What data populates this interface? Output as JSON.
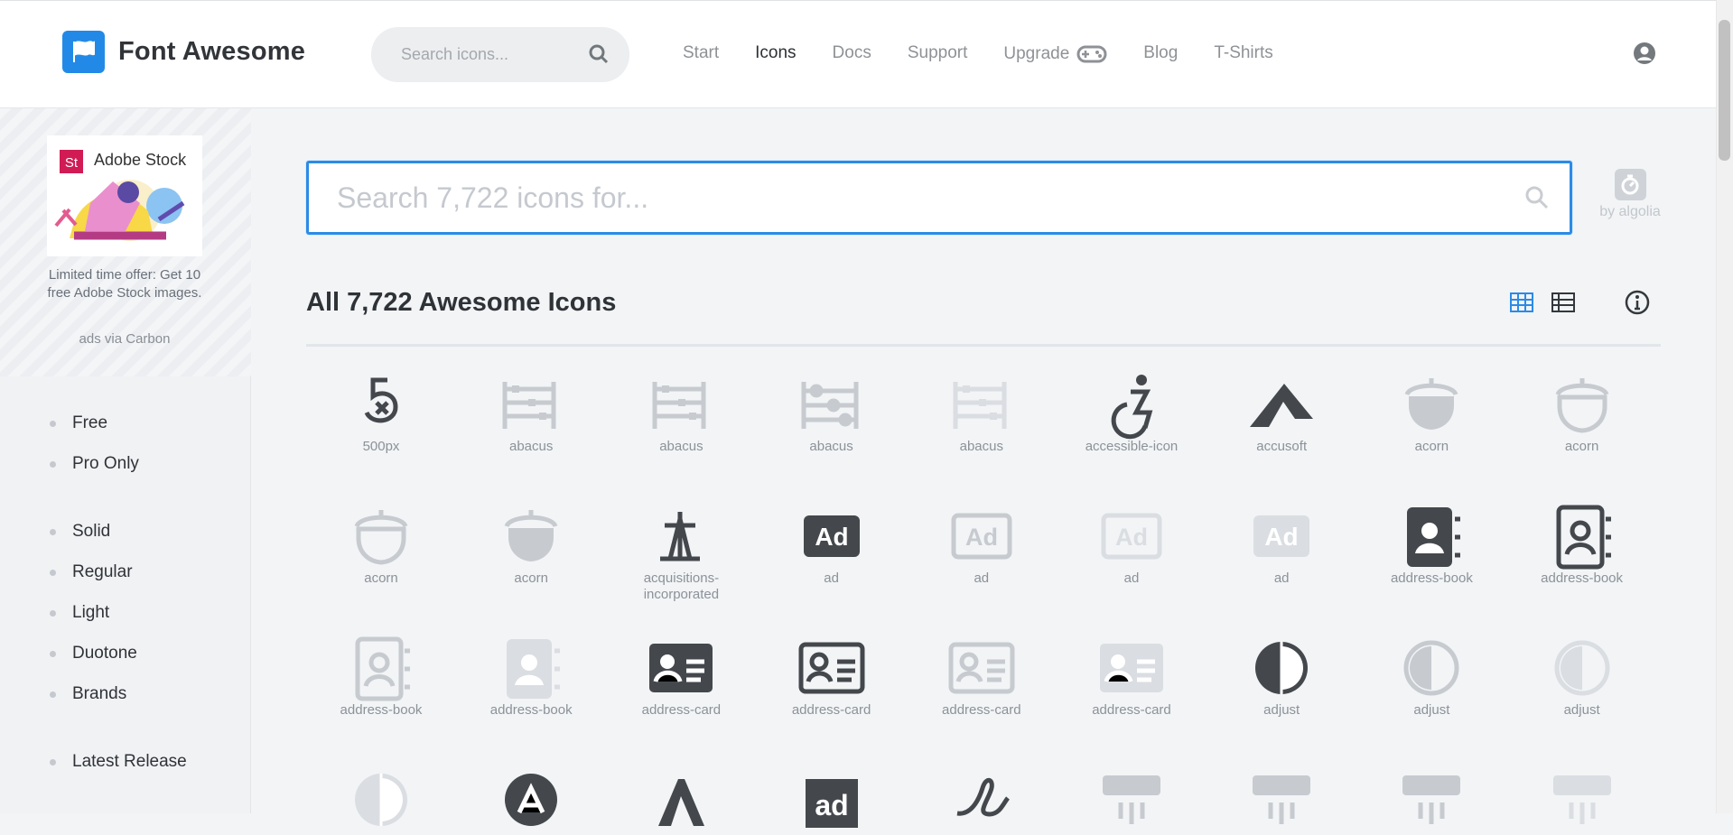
{
  "brand": {
    "name": "Font Awesome",
    "logo_icon": "flag-icon",
    "brand_color": "#228ae6"
  },
  "top_search": {
    "placeholder": "Search icons...",
    "icon": "search-icon"
  },
  "nav": {
    "items": [
      "Start",
      "Icons",
      "Docs",
      "Support",
      "Upgrade",
      "Blog",
      "T-Shirts"
    ],
    "active": "Icons",
    "upgrade_icon": "gamepad-icon"
  },
  "account_icon": "user-circle-icon",
  "ad": {
    "title": "Adobe Stock",
    "badge": "St",
    "copy": "Limited time offer: Get 10 free Adobe Stock images.",
    "via": "ads via Carbon"
  },
  "filters": [
    "Free",
    "Pro Only",
    "Solid",
    "Regular",
    "Light",
    "Duotone",
    "Brands",
    "Latest Release"
  ],
  "main_search": {
    "placeholder": "Search 7,722 icons for...",
    "provider": "by algolia",
    "icon": "search-icon"
  },
  "page_title": "All 7,722 Awesome Icons",
  "view_controls": {
    "grid_icon": "grid-view-icon",
    "list_icon": "table-view-icon",
    "info_icon": "info-circle-icon",
    "active": "grid"
  },
  "icons": [
    {
      "label": "500px",
      "kind": "500px"
    },
    {
      "label": "abacus",
      "kind": "abacus",
      "style": "light"
    },
    {
      "label": "abacus",
      "kind": "abacus",
      "style": "light"
    },
    {
      "label": "abacus",
      "kind": "abacus-ring",
      "style": "light"
    },
    {
      "label": "abacus",
      "kind": "abacus",
      "style": "faded"
    },
    {
      "label": "accessible-icon",
      "kind": "accessible"
    },
    {
      "label": "accusoft",
      "kind": "accusoft"
    },
    {
      "label": "acorn",
      "kind": "acorn",
      "style": "light"
    },
    {
      "label": "acorn",
      "kind": "acorn-outline",
      "style": "light"
    },
    {
      "label": "acorn",
      "kind": "acorn-outline",
      "style": "light"
    },
    {
      "label": "acorn",
      "kind": "acorn",
      "style": "light"
    },
    {
      "label": "acquisitions-incorporated",
      "kind": "acquisitions"
    },
    {
      "label": "ad",
      "kind": "ad",
      "style": "dark"
    },
    {
      "label": "ad",
      "kind": "ad-outline",
      "style": "light"
    },
    {
      "label": "ad",
      "kind": "ad-outline",
      "style": "faded"
    },
    {
      "label": "ad",
      "kind": "ad",
      "style": "faded"
    },
    {
      "label": "address-book",
      "kind": "address-book",
      "style": "dark"
    },
    {
      "label": "address-book",
      "kind": "address-book-outline",
      "style": "dark"
    },
    {
      "label": "address-book",
      "kind": "address-book-outline",
      "style": "light"
    },
    {
      "label": "address-book",
      "kind": "address-book",
      "style": "faded"
    },
    {
      "label": "address-card",
      "kind": "address-card",
      "style": "dark"
    },
    {
      "label": "address-card",
      "kind": "address-card-outline",
      "style": "dark"
    },
    {
      "label": "address-card",
      "kind": "address-card-outline",
      "style": "light"
    },
    {
      "label": "address-card",
      "kind": "address-card",
      "style": "faded"
    },
    {
      "label": "adjust",
      "kind": "adjust",
      "style": "dark"
    },
    {
      "label": "adjust",
      "kind": "adjust-outline",
      "style": "light"
    },
    {
      "label": "adjust",
      "kind": "adjust-outline",
      "style": "faded"
    },
    {
      "label": "",
      "kind": "adjust",
      "style": "faded"
    },
    {
      "label": "",
      "kind": "adversal",
      "style": "dark"
    },
    {
      "label": "",
      "kind": "adobe",
      "style": "dark"
    },
    {
      "label": "",
      "kind": "ad-word",
      "style": "dark"
    },
    {
      "label": "",
      "kind": "wavy",
      "style": "dark"
    },
    {
      "label": "",
      "kind": "air-conditioner",
      "style": "light"
    },
    {
      "label": "",
      "kind": "air-conditioner",
      "style": "light"
    },
    {
      "label": "",
      "kind": "air-conditioner",
      "style": "light"
    },
    {
      "label": "",
      "kind": "air-conditioner",
      "style": "faded"
    }
  ]
}
